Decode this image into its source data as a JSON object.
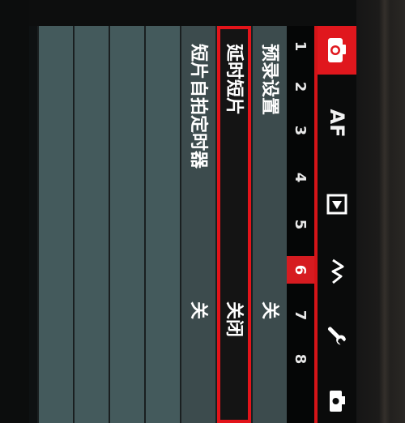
{
  "tabs": [
    {
      "name": "shoot",
      "label": "",
      "icon": "camera-icon",
      "active": true
    },
    {
      "name": "af",
      "label": "AF",
      "icon": "",
      "active": false
    },
    {
      "name": "playback",
      "label": "",
      "icon": "play-icon",
      "active": false
    },
    {
      "name": "custom",
      "label": "",
      "icon": "custom-function-icon",
      "active": false
    },
    {
      "name": "setup",
      "label": "",
      "icon": "wrench-icon",
      "active": false
    },
    {
      "name": "my-menu",
      "label": "",
      "icon": "camera-icon",
      "active": false
    }
  ],
  "pages": [
    "1",
    "2",
    "3",
    "4",
    "5",
    "6",
    "7",
    "8"
  ],
  "active_page": "6",
  "menu_items": [
    {
      "label": "预录设置",
      "value": "关"
    },
    {
      "label": "延时短片",
      "value": "关闭"
    },
    {
      "label": "短片自拍定时器",
      "value": "关"
    }
  ],
  "selected_index": 1,
  "colors": {
    "accent": "#e0171d",
    "row_bg": "#3c4b4d",
    "selected_bg": "#141414"
  }
}
